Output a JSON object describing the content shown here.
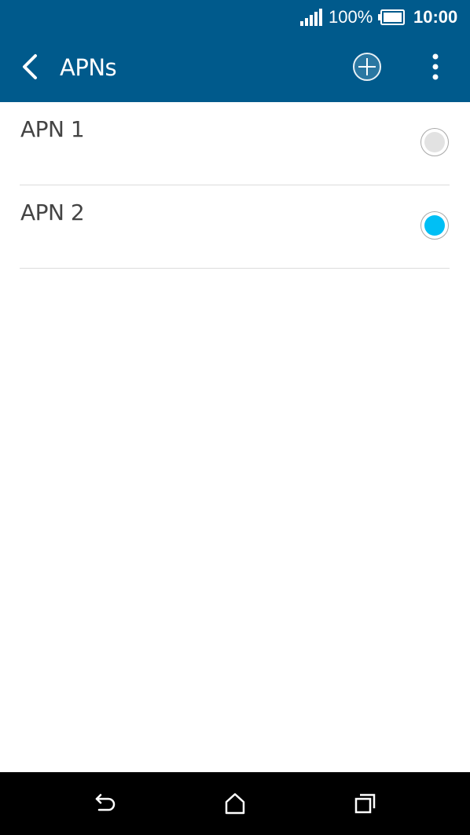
{
  "status_bar": {
    "signal_icon": "signal-bars-icon",
    "battery_percent": "100%",
    "battery_icon": "battery-full-icon",
    "time": "10:00"
  },
  "app_bar": {
    "title": "APNs",
    "back_icon": "chevron-left-icon",
    "add_icon": "plus-circle-icon",
    "more_icon": "more-vertical-icon"
  },
  "apn_list": {
    "items": [
      {
        "label": "APN 1",
        "selected": false
      },
      {
        "label": "APN 2",
        "selected": true
      }
    ]
  },
  "nav_bar": {
    "back_icon": "back-arrow-icon",
    "home_icon": "home-icon",
    "recents_icon": "recent-apps-icon"
  },
  "colors": {
    "primary": "#005a8c",
    "radio_selected": "#00bff5",
    "radio_unselected": "#e2e2e2",
    "divider": "#dcdcdc",
    "text": "#444444"
  }
}
